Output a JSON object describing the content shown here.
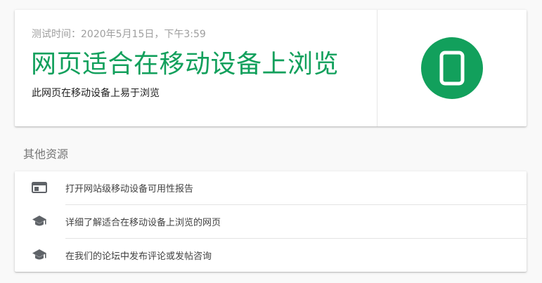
{
  "result": {
    "test_time": "测试时间：2020年5月15日，下午3:59",
    "verdict": "网页适合在移动设备上浏览",
    "verdict_detail": "此网页在移动设备上易于浏览",
    "badge_icon": "mobile-phone-icon",
    "accent_color": "#12a05c"
  },
  "resources": {
    "heading": "其他资源",
    "items": [
      {
        "icon": "web-report-icon",
        "label": "打开网站级移动设备可用性报告"
      },
      {
        "icon": "graduation-cap-icon",
        "label": "详细了解适合在移动设备上浏览的网页"
      },
      {
        "icon": "graduation-cap-icon",
        "label": "在我们的论坛中发布评论或发帖咨询"
      }
    ]
  }
}
